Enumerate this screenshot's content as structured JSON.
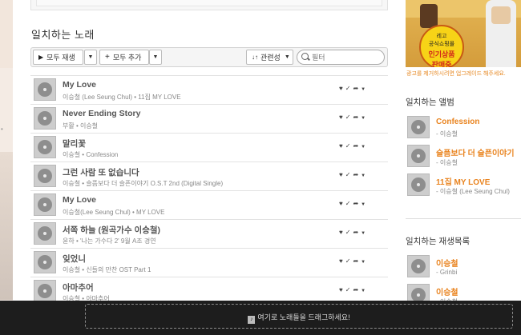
{
  "section_title": "일치하는 노래",
  "toolbar": {
    "play_all": "모두 재생",
    "add_all": "모두 추가",
    "sort": "관련성",
    "search_placeholder": "필터",
    "icons": [
      "play-icon",
      "plus-icon",
      "sort-icon",
      "chevron-down-icon",
      "search-icon"
    ]
  },
  "songs": [
    {
      "title": "My Love",
      "sub": "이승철 (Lee Seung Chul) • 11집 MY LOVE"
    },
    {
      "title": "Never Ending Story",
      "sub": "부활 • 이승철"
    },
    {
      "title": "말리꽃",
      "sub": "이승철 • Confession"
    },
    {
      "title": "그런 사람 또 없습니다",
      "sub": "이승철 • 슬픔보다 더 슬픈이야기 O.S.T 2nd (Digital Single)"
    },
    {
      "title": "My Love",
      "sub": "이승철(Lee Seung Chul) • MY LOVE"
    },
    {
      "title": "서쪽 하늘 (원곡가수 이승철)",
      "sub": "윤하 • '나는 가수다 2' 9월 A조 경연"
    },
    {
      "title": "잊었니",
      "sub": "이승철 • 신들의 만찬 OST Part 1"
    },
    {
      "title": "아마추어",
      "sub": "이승철 • 아마추어"
    }
  ],
  "row_actions": [
    "heart-icon",
    "check-icon",
    "share-icon",
    "chevron-down-icon"
  ],
  "ad": {
    "line1": "레고",
    "line2": "공식쇼핑몰",
    "line3": "인기상품",
    "line4": "판매중",
    "caption": "광고를 제거하시려면 업그레이드 해주세요."
  },
  "albums": {
    "heading": "일치하는 앨범",
    "items": [
      {
        "title": "Confession",
        "sub": "- 이승철"
      },
      {
        "title": "슬픔보다 더 슬픈이야기",
        "sub": "- 이승철"
      },
      {
        "title": "11집 MY LOVE",
        "sub": "- 이승철 (Lee Seung Chul)"
      }
    ]
  },
  "playlists": {
    "heading": "일치하는 재생목록",
    "items": [
      {
        "title": "이승철",
        "sub": "- Grinbi"
      },
      {
        "title": "이승철",
        "sub": "- 이승철"
      }
    ]
  },
  "drag_bar": {
    "text": "여기로 노래들을 드래그하세요!"
  },
  "colors": {
    "accent": "#e98420",
    "drag_bar_bg": "#1d1d1d"
  }
}
